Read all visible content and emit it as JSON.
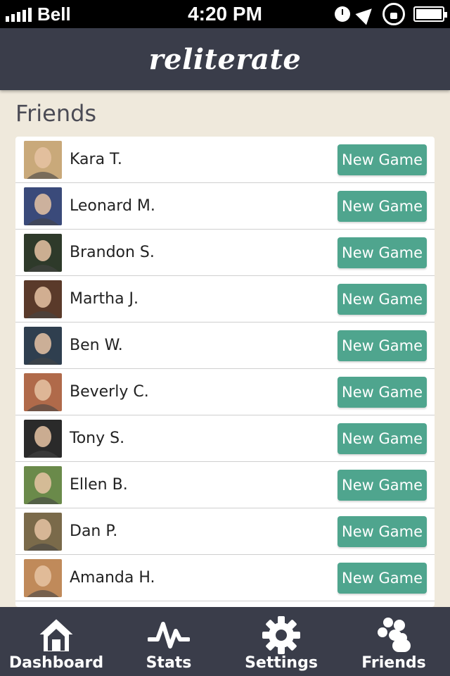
{
  "status_bar": {
    "carrier": "Bell",
    "time": "4:20 PM"
  },
  "header": {
    "title": "reliterate"
  },
  "page": {
    "heading": "Friends"
  },
  "friends": [
    {
      "name": "Kara T.",
      "button": "New Game",
      "avatar_color": "#c9a97a"
    },
    {
      "name": "Leonard M.",
      "button": "New Game",
      "avatar_color": "#3a4a7a"
    },
    {
      "name": "Brandon S.",
      "button": "New Game",
      "avatar_color": "#2e3a2a"
    },
    {
      "name": "Martha J.",
      "button": "New Game",
      "avatar_color": "#5a3a2a"
    },
    {
      "name": "Ben W.",
      "button": "New Game",
      "avatar_color": "#2f3f4f"
    },
    {
      "name": "Beverly C.",
      "button": "New Game",
      "avatar_color": "#b06a4a"
    },
    {
      "name": "Tony S.",
      "button": "New Game",
      "avatar_color": "#2a2a2a"
    },
    {
      "name": "Ellen B.",
      "button": "New Game",
      "avatar_color": "#6a8a4a"
    },
    {
      "name": "Dan P.",
      "button": "New Game",
      "avatar_color": "#7a6a4a"
    },
    {
      "name": "Amanda H.",
      "button": "New Game",
      "avatar_color": "#c08a5a"
    }
  ],
  "tabs": [
    {
      "label": "Dashboard",
      "icon": "home-icon"
    },
    {
      "label": "Stats",
      "icon": "stats-icon"
    },
    {
      "label": "Settings",
      "icon": "gear-icon"
    },
    {
      "label": "Friends",
      "icon": "friends-icon"
    }
  ],
  "colors": {
    "header_bg": "#3a3d4a",
    "accent": "#4fa58e",
    "page_bg": "#efe9dc"
  }
}
